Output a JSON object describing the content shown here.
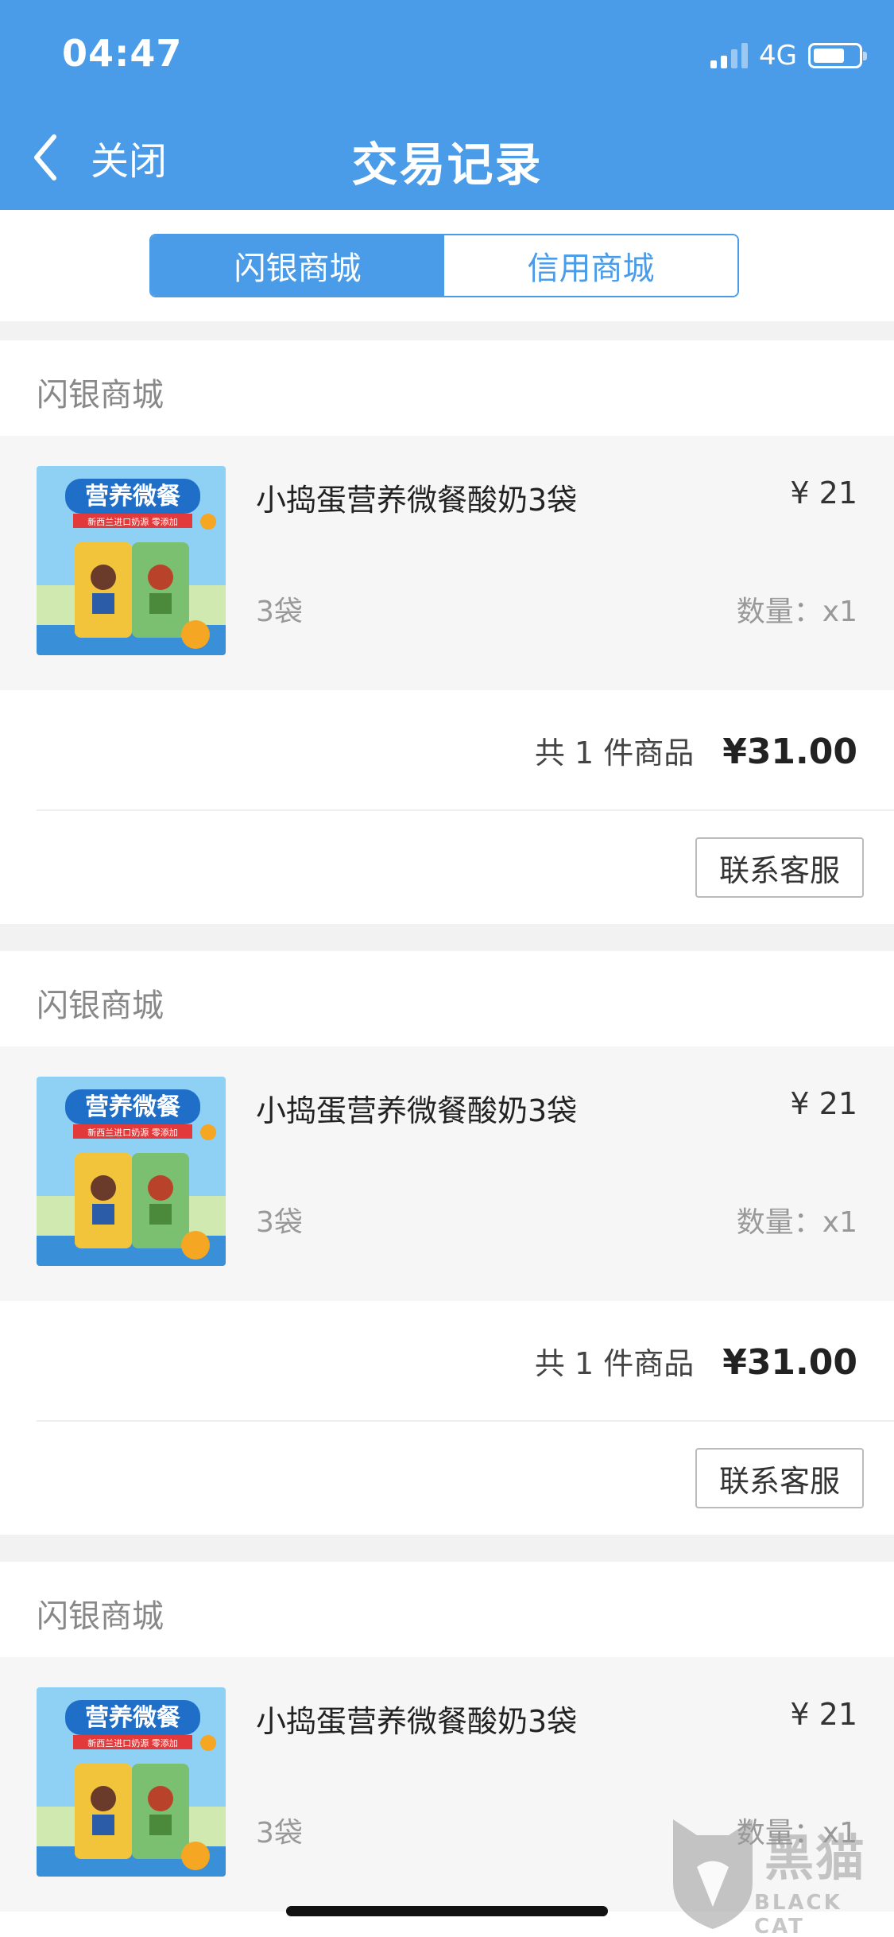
{
  "status_bar": {
    "time": "04:47",
    "network": "4G"
  },
  "nav": {
    "close_label": "关闭",
    "title": "交易记录"
  },
  "tabs": [
    {
      "label": "闪银商城",
      "active": true
    },
    {
      "label": "信用商城",
      "active": false
    }
  ],
  "orders": [
    {
      "shop": "闪银商城",
      "product": {
        "name": "小捣蛋营养微餐酸奶3袋",
        "price": "¥ 21",
        "spec": "3袋",
        "quantity": "数量：x1",
        "image_text": {
          "headline": "营养微餐",
          "tagline": "新西兰进口奶源 零添加"
        }
      },
      "summary": {
        "count": "共 1 件商品",
        "total": "¥31.00"
      },
      "action": "联系客服"
    },
    {
      "shop": "闪银商城",
      "product": {
        "name": "小捣蛋营养微餐酸奶3袋",
        "price": "¥ 21",
        "spec": "3袋",
        "quantity": "数量：x1",
        "image_text": {
          "headline": "营养微餐",
          "tagline": "新西兰进口奶源 零添加"
        }
      },
      "summary": {
        "count": "共 1 件商品",
        "total": "¥31.00"
      },
      "action": "联系客服"
    },
    {
      "shop": "闪银商城",
      "product": {
        "name": "小捣蛋营养微餐酸奶3袋",
        "price": "¥ 21",
        "spec": "3袋",
        "quantity": "数量：x1",
        "image_text": {
          "headline": "营养微餐",
          "tagline": "新西兰进口奶源 零添加"
        }
      }
    }
  ],
  "watermark": {
    "text": "黑猫",
    "sub": "BLACK CAT"
  },
  "colors": {
    "accent": "#4a9ce8",
    "section_bg": "#f6f6f6",
    "page_bg": "#f2f2f2"
  }
}
